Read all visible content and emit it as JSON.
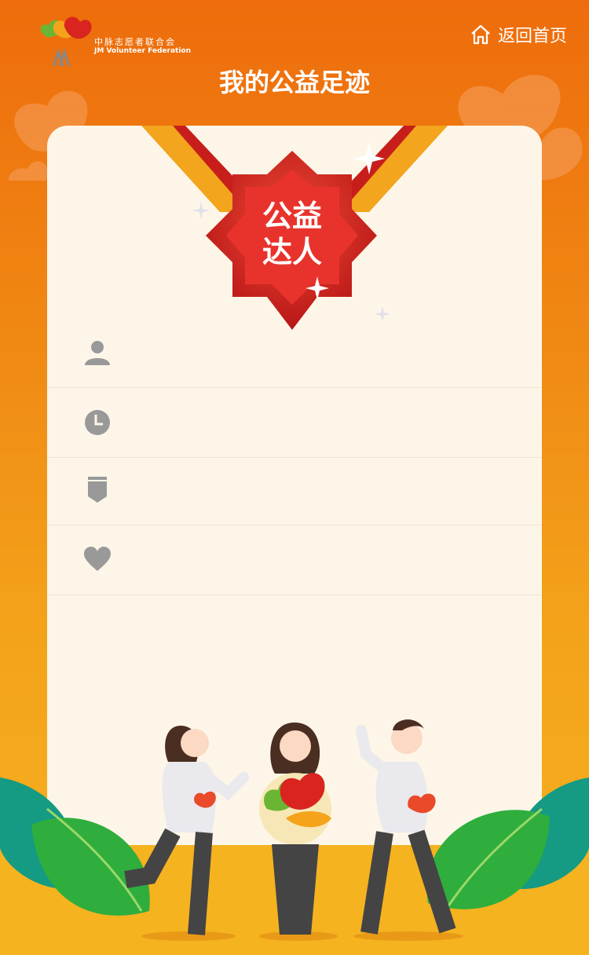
{
  "header": {
    "logo_cn": "中脉志愿者联合会",
    "logo_en": "JM Volunteer Federation",
    "home_label": "返回首页",
    "title": "我的公益足迹"
  },
  "badge": {
    "line1": "公益",
    "line2": "达人"
  },
  "info_rows": [
    {
      "icon": "user-icon",
      "value": ""
    },
    {
      "icon": "clock-icon",
      "value": ""
    },
    {
      "icon": "bookmark-icon",
      "value": ""
    },
    {
      "icon": "heart-icon",
      "value": ""
    }
  ],
  "colors": {
    "orange_top": "#ee6c0c",
    "orange_bottom": "#f5b21e",
    "badge_red": "#d9241f",
    "card_bg": "#fdf6e8",
    "icon_gray": "#999999"
  }
}
